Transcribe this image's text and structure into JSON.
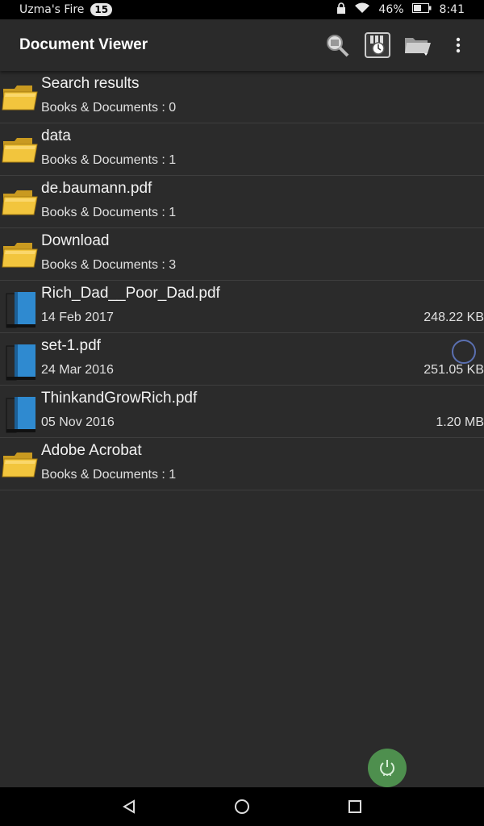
{
  "status": {
    "carrier": "Uzma's Fire",
    "notif_count": "15",
    "battery": "46%",
    "time": "8:41"
  },
  "toolbar": {
    "title": "Document Viewer",
    "icons": [
      "search-icon",
      "history-icon",
      "folder-open-icon",
      "more-vert-icon"
    ]
  },
  "files": [
    {
      "type": "folder",
      "name": "Search results",
      "sub": "Books & Documents : 0",
      "size": ""
    },
    {
      "type": "folder",
      "name": "data",
      "sub": "Books & Documents : 1",
      "size": ""
    },
    {
      "type": "folder",
      "name": "de.baumann.pdf",
      "sub": "Books & Documents : 1",
      "size": ""
    },
    {
      "type": "folder",
      "name": "Download",
      "sub": "Books & Documents : 3",
      "size": ""
    },
    {
      "type": "book",
      "name": "Rich_Dad__Poor_Dad.pdf",
      "sub": "14 Feb 2017",
      "size": "248.22 KB"
    },
    {
      "type": "book",
      "name": "set-1.pdf",
      "sub": "24 Mar 2016",
      "size": "251.05 KB",
      "loading": true
    },
    {
      "type": "book",
      "name": "ThinkandGrowRich.pdf",
      "sub": "05 Nov 2016",
      "size": "1.20 MB"
    },
    {
      "type": "folder",
      "name": "Adobe Acrobat",
      "sub": "Books & Documents : 1",
      "size": ""
    }
  ],
  "colors": {
    "fab": "#4e8f4e",
    "folder": "#f2c53d",
    "book": "#2f8ad0"
  }
}
